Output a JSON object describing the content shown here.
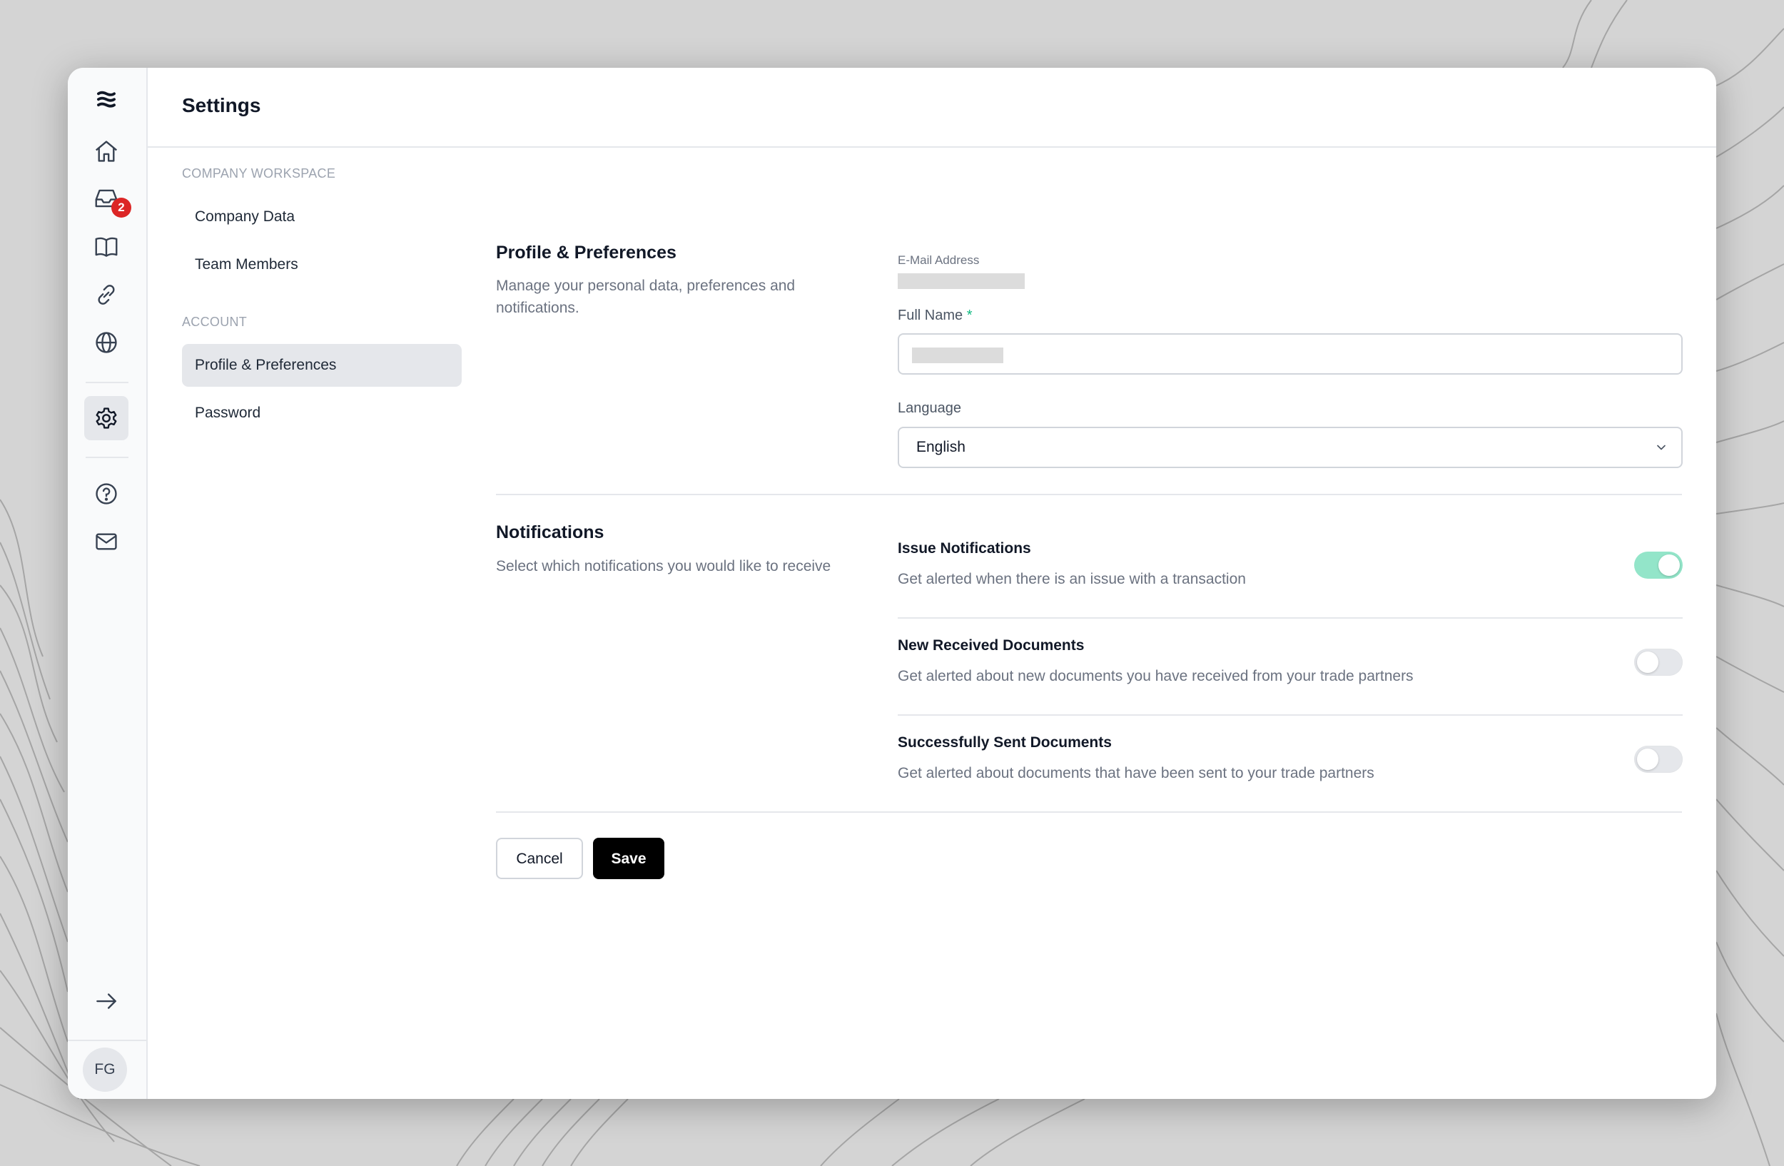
{
  "app": {
    "logo_icon": "waves-logo-icon"
  },
  "rail": {
    "items": [
      {
        "name": "home",
        "icon": "home-icon"
      },
      {
        "name": "inbox",
        "icon": "inbox-icon",
        "badge": "2"
      },
      {
        "name": "book",
        "icon": "book-icon"
      },
      {
        "name": "link",
        "icon": "link-icon"
      },
      {
        "name": "globe",
        "icon": "globe-icon"
      },
      {
        "name": "settings",
        "icon": "gear-icon",
        "active": true
      },
      {
        "name": "help",
        "icon": "help-circle-icon"
      },
      {
        "name": "mail",
        "icon": "mail-icon"
      },
      {
        "name": "logout",
        "icon": "arrow-right-icon"
      }
    ],
    "avatar_initials": "FG"
  },
  "header": {
    "title": "Settings"
  },
  "settings_nav": {
    "groups": [
      {
        "heading": "COMPANY WORKSPACE",
        "items": [
          {
            "label": "Company Data"
          },
          {
            "label": "Team Members"
          }
        ]
      },
      {
        "heading": "ACCOUNT",
        "items": [
          {
            "label": "Profile & Preferences",
            "active": true
          },
          {
            "label": "Password"
          }
        ]
      }
    ]
  },
  "profile": {
    "title": "Profile & Preferences",
    "description": "Manage your personal data, preferences and notifications.",
    "email_label": "E-Mail Address",
    "full_name_label": "Full Name",
    "required_marker": "*",
    "language_label": "Language",
    "language_value": "English"
  },
  "notifications": {
    "title": "Notifications",
    "description": "Select which notifications you would like to receive",
    "items": [
      {
        "title": "Issue Notifications",
        "description": "Get alerted when there is an issue with a transaction",
        "enabled": true
      },
      {
        "title": "New Received Documents",
        "description": "Get alerted about new documents you have received from your trade partners",
        "enabled": false
      },
      {
        "title": "Successfully Sent Documents",
        "description": "Get alerted about documents that have been sent to your trade partners",
        "enabled": false
      }
    ]
  },
  "actions": {
    "cancel_label": "Cancel",
    "save_label": "Save"
  },
  "colors": {
    "accent_toggle_on": "#93e5c9",
    "badge": "#dc2626",
    "required": "#10b981",
    "primary_button": "#000000"
  }
}
